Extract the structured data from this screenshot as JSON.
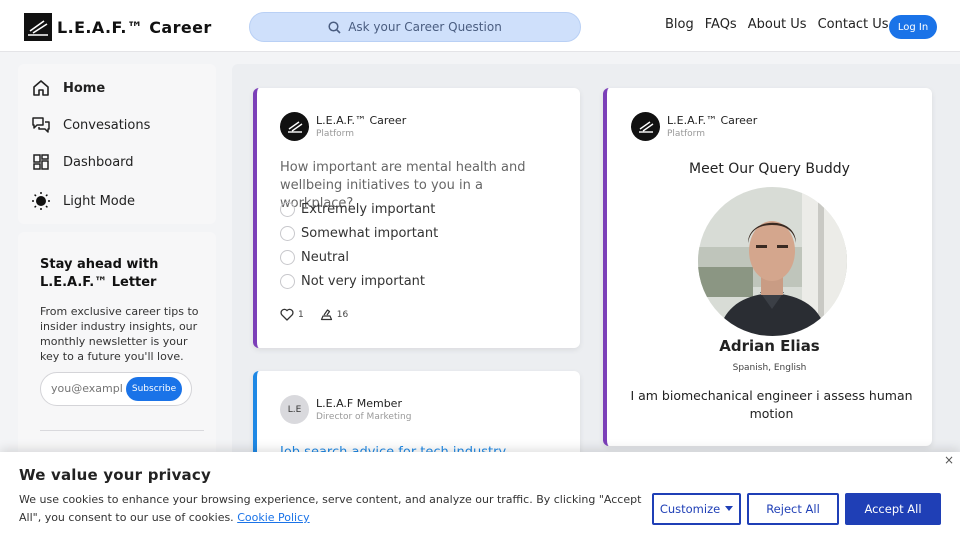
{
  "header": {
    "brand": "L.E.A.F.™ Career",
    "search_placeholder": "Ask your Career Question",
    "nav": [
      "Blog",
      "FAQs",
      "About Us",
      "Contact Us"
    ],
    "login": "Log In"
  },
  "sidebar": {
    "items": [
      {
        "label": "Home",
        "icon": "home-icon"
      },
      {
        "label": "Convesations",
        "icon": "chat-icon"
      },
      {
        "label": "Dashboard",
        "icon": "dashboard-icon"
      },
      {
        "label": "Light Mode",
        "icon": "sun-icon"
      }
    ],
    "newsletter": {
      "title": "Stay ahead with L.E.A.F.™ Letter",
      "text": "From exclusive career tips to insider industry insights, our monthly newsletter is your key to a future you'll love.",
      "placeholder": "you@example.com",
      "button": "Subscribe"
    }
  },
  "poll_card": {
    "author": "L.E.A.F.™ Career",
    "role": "Platform",
    "question": "How important are mental health and wellbeing initiatives to you in a workplace?",
    "options": [
      "Extremely important",
      "Somewhat important",
      "Neutral",
      "Not very important"
    ],
    "likes": "1",
    "votes": "16"
  },
  "buddy_card": {
    "author": "L.E.A.F.™ Career",
    "role": "Platform",
    "title": "Meet Our Query Buddy",
    "name": "Adrian Elias",
    "languages": "Spanish, English",
    "bio": "I am biomechanical engineer i assess human motion"
  },
  "member_card": {
    "avatar": "L.E",
    "author": "L.E.A.F Member",
    "role": "Director of Marketing",
    "question": "Job search advice for tech industry"
  },
  "cookie": {
    "title": "We value your privacy",
    "text": "We use cookies to enhance your browsing experience, serve content, and analyze our traffic. By clicking \"Accept All\", you consent to our use of cookies.",
    "link": "Cookie Policy",
    "customize": "Customize",
    "reject": "Reject All",
    "accept": "Accept All",
    "close": "×"
  },
  "colors": {
    "accent": "#1a73e8",
    "cookie_button": "#1f3fb6",
    "card_border_purple": "#7b3fb8",
    "card_border_blue": "#1e88e5"
  }
}
